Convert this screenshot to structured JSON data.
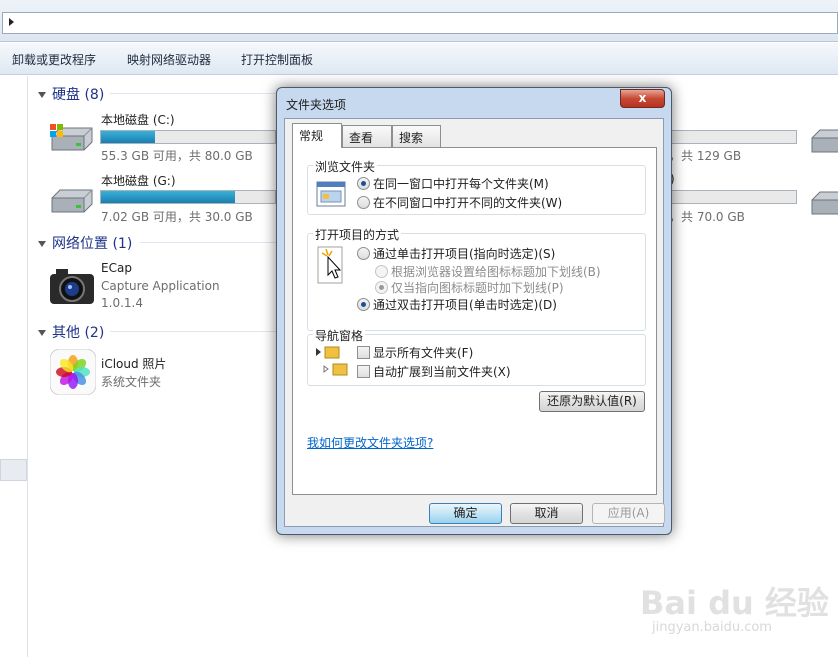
{
  "toolbar": {
    "items": [
      "卸载或更改程序",
      "映射网络驱动器",
      "打开控制面板"
    ]
  },
  "groups": {
    "hard_disks": "硬盘 (8)",
    "network": "网络位置 (1)",
    "other": "其他 (2)"
  },
  "drives": [
    {
      "name": "本地磁盘 (C:)",
      "space": "55.3 GB 可用，共 80.0 GB",
      "used_fraction": 0.31
    },
    {
      "name": "本地磁盘 (G:)",
      "space": "7.02 GB 可用，共 30.0 GB",
      "used_fraction": 0.77
    }
  ],
  "drives_right": [
    {
      "name_fragment": "",
      "space_fragment": "，共 129 GB"
    },
    {
      "name_fragment": ")",
      "space_fragment": "，共 70.0 GB"
    }
  ],
  "network_item": {
    "title": "ECap",
    "line1": "Capture Application",
    "line2": "1.0.1.4"
  },
  "other_item": {
    "title": "iCloud 照片",
    "subtitle": "系统文件夹"
  },
  "dialog": {
    "title": "文件夹选项",
    "close": "x",
    "tabs": [
      "常规",
      "查看",
      "搜索"
    ],
    "browse_group": {
      "title": "浏览文件夹",
      "options": [
        "在同一窗口中打开每个文件夹(M)",
        "在不同窗口中打开不同的文件夹(W)"
      ]
    },
    "click_group": {
      "title": "打开项目的方式",
      "single": "通过单击打开项目(指向时选定)(S)",
      "sub1": "根据浏览器设置给图标标题加下划线(B)",
      "sub2": "仅当指向图标标题时加下划线(P)",
      "double": "通过双击打开项目(单击时选定)(D)"
    },
    "nav_group": {
      "title": "导航窗格",
      "options": [
        "显示所有文件夹(F)",
        "自动扩展到当前文件夹(X)"
      ]
    },
    "restore": "还原为默认值(R)",
    "link": "我如何更改文件夹选项?",
    "ok": "确定",
    "cancel": "取消",
    "apply": "应用(A)"
  },
  "watermark": {
    "text": "Bai du 经验",
    "url": "jingyan.baidu.com"
  }
}
